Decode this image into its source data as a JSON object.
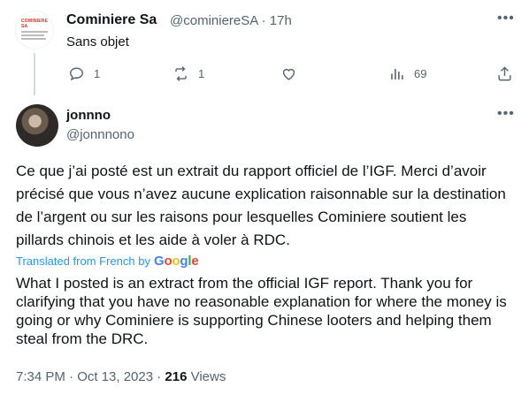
{
  "parent_tweet": {
    "author_name": "Cominiere Sa",
    "handle": "@cominiereSA",
    "separator": "·",
    "time": "17h",
    "text": "Sans objet",
    "avatar_logo_text": "COMINIERE SA",
    "actions": {
      "replies": "1",
      "retweets": "1",
      "likes": "",
      "views": "69"
    }
  },
  "tweet": {
    "author_name": "jonnno",
    "handle": "@jonnnono",
    "text": "Ce que j’ai posté est un extrait du rapport officiel de l’IGF. Merci d’avoir précisé que vous n’avez aucune explication raisonnable sur la destination de l’argent ou sur les raisons pour lesquelles Cominiere soutient les pillards chinois et les aide à voler à RDC.",
    "translated_label": "Translated from French by",
    "translation_provider": "Google",
    "translation": "What I posted is an extract from the official IGF report. Thank you for clarifying that you have no reasonable explanation for where the money is going or why Cominiere is supporting Chinese looters and helping them steal from the DRC.",
    "timestamp": "7:34 PM · Oct 13, 2023 · ",
    "views_count": "216",
    "views_label": " Views"
  },
  "colors": {
    "link": "#1d9bf0",
    "muted": "#536471",
    "text": "#0f1419"
  }
}
